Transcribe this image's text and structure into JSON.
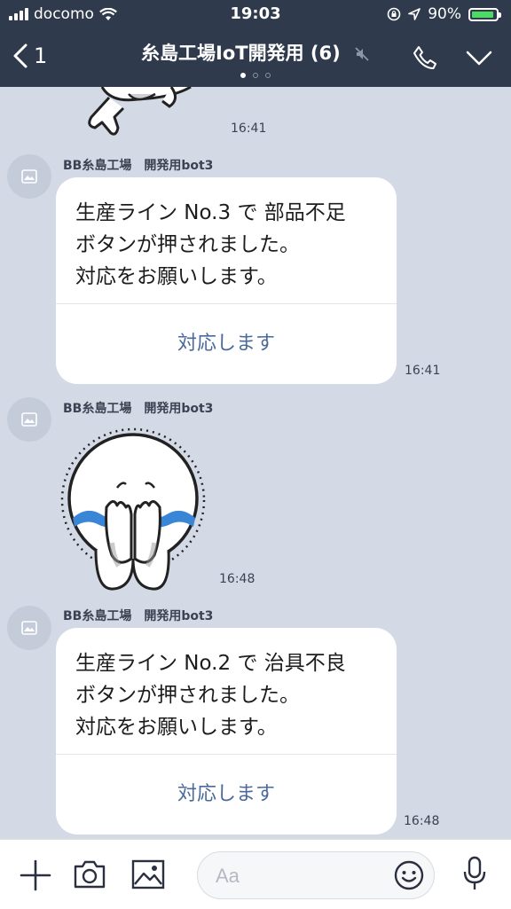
{
  "status_bar": {
    "carrier": "docomo",
    "time": "19:03",
    "battery": "90%"
  },
  "header": {
    "back_count": "1",
    "title": "糸島工場IoT開発用 (6)"
  },
  "messages": [
    {
      "type": "sticker_fragment",
      "time": "16:41"
    },
    {
      "type": "card",
      "sender": "BB糸島工場　開発用bot3",
      "lines": [
        "生産ライン No.3 で 部品不足",
        "ボタンが押されました。",
        "対応をお願いします。"
      ],
      "action": "対応します",
      "time": "16:41"
    },
    {
      "type": "sticker",
      "sender": "BB糸島工場　開発用bot3",
      "time": "16:48"
    },
    {
      "type": "card",
      "sender": "BB糸島工場　開発用bot3",
      "lines": [
        "生産ライン No.2 で 治具不良",
        "ボタンが押されました。",
        "対応をお願いします。"
      ],
      "action": "対応します",
      "time": "16:48"
    }
  ],
  "input": {
    "placeholder": "Aa"
  },
  "colors": {
    "header_bg": "#2f3a4c",
    "chat_bg": "#d3d9e5",
    "action_text": "#4b6a9b",
    "battery": "#4cd964"
  },
  "icons": [
    "signal-icon",
    "wifi-icon",
    "lock-rotation-icon",
    "location-icon",
    "battery-icon",
    "back-chevron-icon",
    "mute-icon",
    "phone-icon",
    "chevron-down-icon",
    "plus-icon",
    "camera-icon",
    "image-icon",
    "emoji-icon",
    "microphone-icon"
  ]
}
